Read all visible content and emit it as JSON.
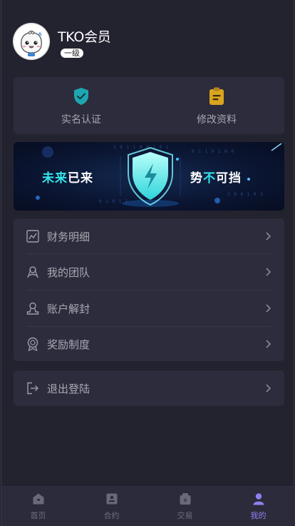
{
  "profile": {
    "name": "TKO会员",
    "level": "一级"
  },
  "quick": [
    {
      "label": "实名认证",
      "icon": "shield-check-icon",
      "color": "#1ea7b0"
    },
    {
      "label": "修改资料",
      "icon": "clipboard-edit-icon",
      "color": "#d9a520"
    }
  ],
  "banner": {
    "left_text_1": "未来",
    "left_text_2": "已来",
    "right_text_1": "势",
    "right_text_2": "不",
    "right_text_3": "可挡"
  },
  "menu": [
    {
      "label": "财务明细",
      "icon": "chart-icon"
    },
    {
      "label": "我的团队",
      "icon": "team-icon"
    },
    {
      "label": "账户解封",
      "icon": "user-unlock-icon"
    },
    {
      "label": "奖励制度",
      "icon": "award-icon"
    }
  ],
  "logout": {
    "label": "退出登陆",
    "icon": "logout-icon"
  },
  "tabs": [
    {
      "label": "首页",
      "icon": "home-icon",
      "active": false
    },
    {
      "label": "合约",
      "icon": "contract-icon",
      "active": false
    },
    {
      "label": "交易",
      "icon": "trade-icon",
      "active": false
    },
    {
      "label": "我的",
      "icon": "person-icon",
      "active": true
    }
  ],
  "colors": {
    "background": "#23222f",
    "card": "#2d2c3c",
    "accent": "#8d81f2",
    "banner_cyan": "#35e6ec"
  }
}
